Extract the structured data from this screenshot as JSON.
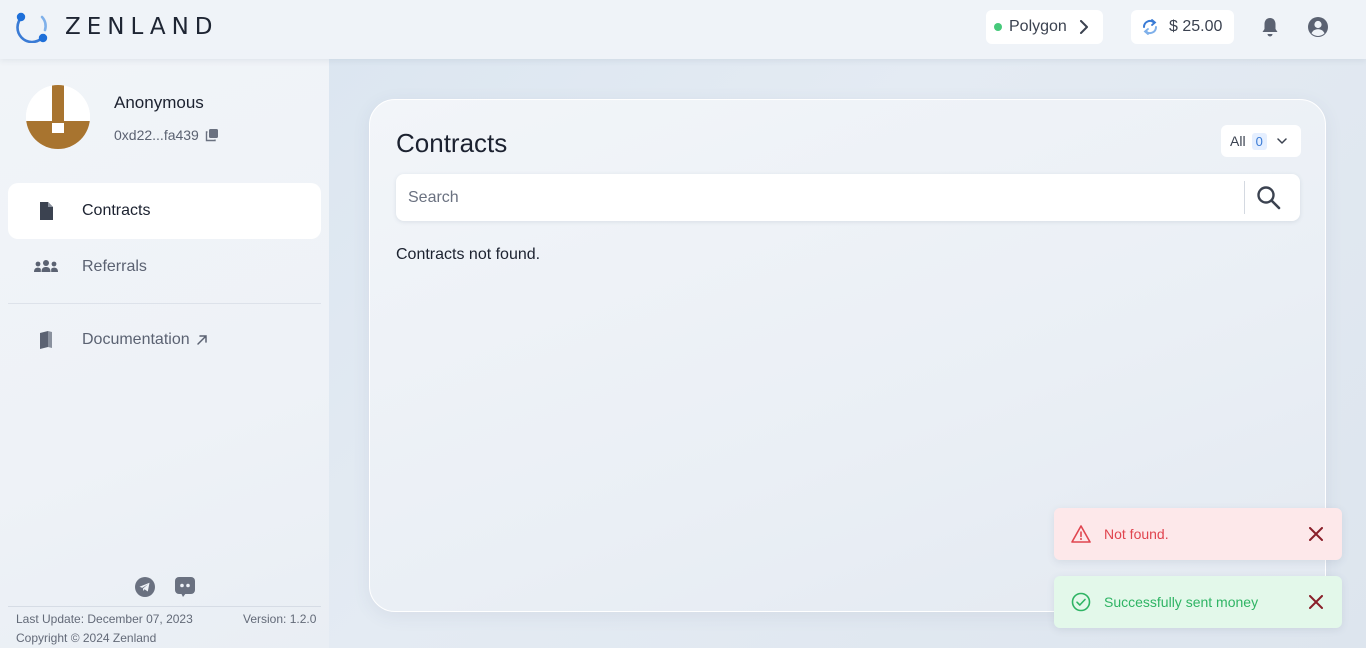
{
  "header": {
    "logo_text": "ZENLAND",
    "network_label": "Polygon",
    "balance_label": "$ 25.00"
  },
  "sidebar": {
    "username": "Anonymous",
    "address": "0xd22...fa439",
    "nav": [
      {
        "label": "Contracts",
        "icon": "document-icon",
        "active": true
      },
      {
        "label": "Referrals",
        "icon": "users-icon",
        "active": false
      },
      {
        "label": "Documentation",
        "icon": "book-icon",
        "active": false,
        "external": true
      }
    ],
    "social": [
      "telegram-icon",
      "discord-icon"
    ],
    "footer": {
      "last_update": "Last Update: December 07, 2023",
      "version": "Version: 1.2.0",
      "copyright": "Copyright © 2024 Zenland"
    }
  },
  "main": {
    "title": "Contracts",
    "filter": {
      "label": "All",
      "count": "0"
    },
    "search_placeholder": "Search",
    "empty_message": "Contracts not found."
  },
  "toasts": [
    {
      "type": "error",
      "text": "Not found."
    },
    {
      "type": "success",
      "text": "Successfully sent money"
    }
  ],
  "colors": {
    "accent": "#3a7bd5",
    "network_status": "#46c97a",
    "error": "#e0454f",
    "success": "#2fb464",
    "avatar_brown": "#a8742f"
  }
}
